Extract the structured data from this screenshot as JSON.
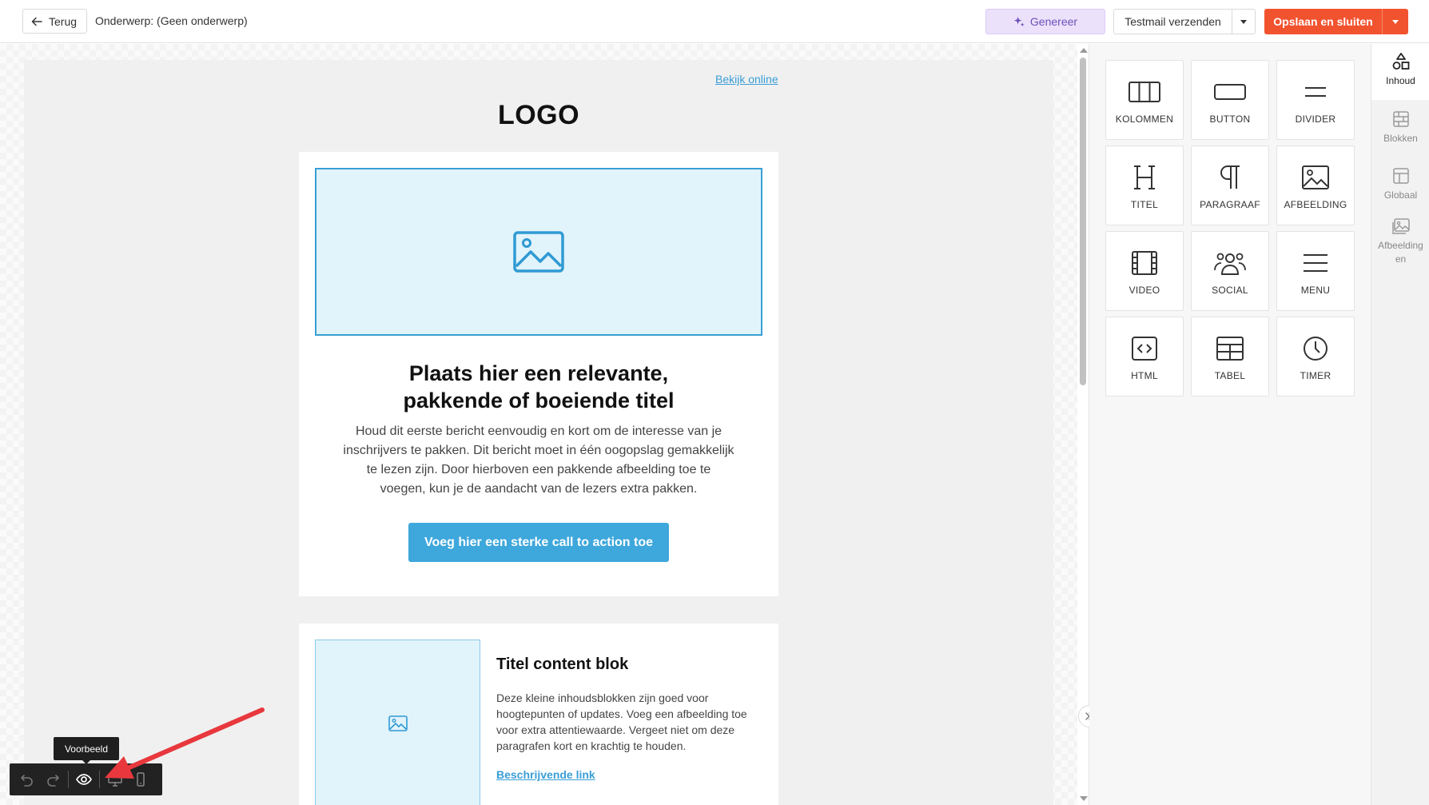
{
  "header": {
    "back_label": "Terug",
    "subject_label": "Onderwerp: (Geen onderwerp)",
    "generate_label": "Genereer",
    "test_mail_label": "Testmail verzenden",
    "save_label": "Opslaan en sluiten"
  },
  "email": {
    "view_online": "Bekijk online",
    "logo_text": "LOGO",
    "block1": {
      "title_line1": "Plaats hier een relevante,",
      "title_line2": "pakkende of boeiende titel",
      "body": "Houd dit eerste bericht eenvoudig en kort om de interesse van je inschrijvers te pakken. Dit bericht moet in één oogopslag gemakkelijk te lezen zijn. Door hierboven een pakkende afbeelding toe te voegen, kun je de aandacht van de lezers extra pakken.",
      "cta": "Voeg hier een sterke call to action toe"
    },
    "block2": {
      "title": "Titel content blok",
      "body": "Deze kleine inhoudsblokken zijn goed voor hoogtepunten of updates. Voeg een afbeelding toe voor extra attentiewaarde. Vergeet niet om deze paragrafen kort en krachtig te houden.",
      "link": "Beschrijvende link"
    }
  },
  "content_tiles": [
    {
      "label": "KOLOMMEN",
      "icon": "columns-icon"
    },
    {
      "label": "BUTTON",
      "icon": "button-icon"
    },
    {
      "label": "DIVIDER",
      "icon": "divider-icon"
    },
    {
      "label": "TITEL",
      "icon": "heading-icon"
    },
    {
      "label": "PARAGRAAF",
      "icon": "paragraph-icon"
    },
    {
      "label": "AFBEELDING",
      "icon": "image-icon"
    },
    {
      "label": "VIDEO",
      "icon": "video-icon"
    },
    {
      "label": "SOCIAL",
      "icon": "social-icon"
    },
    {
      "label": "MENU",
      "icon": "menu-icon"
    },
    {
      "label": "HTML",
      "icon": "code-icon"
    },
    {
      "label": "TABEL",
      "icon": "table-icon"
    },
    {
      "label": "TIMER",
      "icon": "clock-icon"
    }
  ],
  "rail": [
    {
      "label": "Inhoud",
      "icon": "shapes-icon",
      "active": true
    },
    {
      "label": "Blokken",
      "icon": "bricks-icon",
      "active": false
    },
    {
      "label": "Globaal",
      "icon": "layout-icon",
      "active": false
    },
    {
      "label": "Afbeelding en",
      "icon": "images-icon",
      "active": false
    }
  ],
  "toolbar": {
    "tooltip": "Voorbeeld",
    "buttons": [
      "undo-icon",
      "redo-icon",
      "eye-icon",
      "desktop-icon",
      "mobile-icon"
    ]
  },
  "colors": {
    "accent_orange": "#f2532f",
    "accent_blue": "#3ea7dc",
    "generate_purple": "#6e4fb8",
    "annotation_red": "#e8383d"
  }
}
